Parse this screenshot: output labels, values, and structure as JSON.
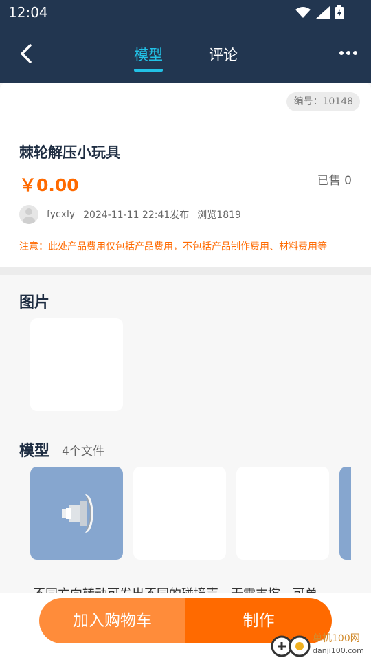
{
  "status": {
    "time": "12:04"
  },
  "header": {
    "tabs": [
      {
        "label": "模型",
        "active": true
      },
      {
        "label": "评论",
        "active": false
      }
    ]
  },
  "product": {
    "code": "编号：10148",
    "title": "棘轮解压小玩具",
    "price": "￥0.00",
    "sold": "已售 0",
    "author": "fycxly",
    "published": "2024-11-11 22:41发布",
    "views": "浏览1819",
    "notice": "注意：此处产品费用仅包括产品费用，不包括产品制作费用、材料费用等"
  },
  "pictures": {
    "title": "图片"
  },
  "models": {
    "title": "模型",
    "count": "4个文件"
  },
  "description": "不同方向转动可发出不同的碰撞声，无需支撑，可单",
  "actions": {
    "add_to_cart": "加入购物车",
    "make": "制作"
  },
  "watermark": {
    "brand": "单机100网",
    "url": "danji100.com"
  },
  "colors": {
    "header_bg": "#223650",
    "accent": "#22c1e6",
    "orange": "#ff6a00",
    "orange_light": "#ff8c3a",
    "tile_blue": "#86a6cf"
  },
  "icons": {
    "back": "back-arrow-icon",
    "more": "more-dots-icon",
    "wifi": "wifi-icon",
    "signal": "signal-icon",
    "battery": "battery-icon"
  }
}
